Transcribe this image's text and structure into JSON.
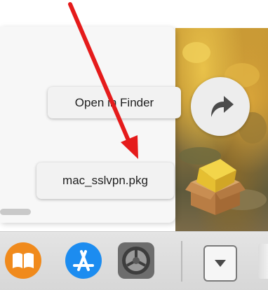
{
  "popover": {
    "open_in_finder_label": "Open in Finder",
    "file_name": "mac_sslvpn.pkg"
  },
  "annotation": {
    "arrow_color": "#e51b1b"
  },
  "dock": {
    "items": [
      "books-icon",
      "app-store-icon",
      "system-preferences-icon",
      "downloads-stack-icon",
      "trash-icon"
    ]
  }
}
